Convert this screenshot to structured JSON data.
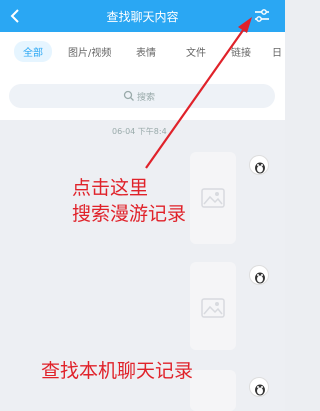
{
  "header": {
    "title": "查找聊天内容",
    "back_icon": "chevron-left-icon",
    "filter_icon": "sliders-icon",
    "color": "#2aa7f3"
  },
  "tabs": [
    {
      "label": "全部",
      "active": true
    },
    {
      "label": "图片/视频",
      "active": false
    },
    {
      "label": "表情",
      "active": false
    },
    {
      "label": "文件",
      "active": false
    },
    {
      "label": "链接",
      "active": false
    },
    {
      "label": "日",
      "active": false
    }
  ],
  "search": {
    "placeholder": "搜索",
    "icon": "search-icon"
  },
  "chat": {
    "timestamp": "06-04 下午8:4"
  },
  "annotations": {
    "tap_here_line1": "点击这里",
    "tap_here_line2": "搜索漫游记录",
    "local_search": "查找本机聊天记录",
    "color": "#e0222a"
  }
}
